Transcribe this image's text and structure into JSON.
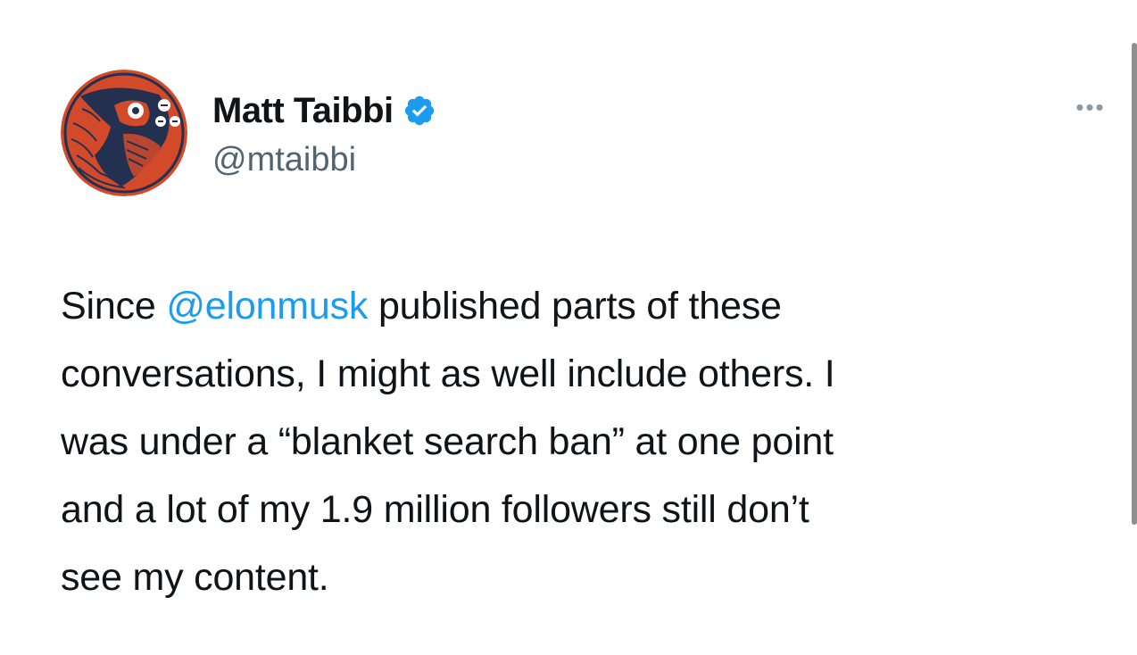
{
  "tweet": {
    "author": {
      "display_name": "Matt Taibbi",
      "handle": "@mtaibbi",
      "verified_icon": "verified-badge-icon",
      "badge_color": "#1d9bf0",
      "avatar_icon": "fish-illustration-avatar"
    },
    "more_icon": "more-options-icon",
    "more_label": "•••",
    "text": {
      "line1_prefix": "Since ",
      "mention": "@elonmusk",
      "line1_suffix": " published parts of these",
      "line2": "conversations, I might as well include others. I",
      "line3": "was under a “blanket search ban” at one point",
      "line4": "and a lot of my 1.9 million followers still don’t",
      "line5": "see my content."
    },
    "colors": {
      "text": "#0f1419",
      "secondary": "#536471",
      "link": "#1d9bf0",
      "avatar_red": "#d24a2a",
      "avatar_navy": "#23304f"
    }
  }
}
